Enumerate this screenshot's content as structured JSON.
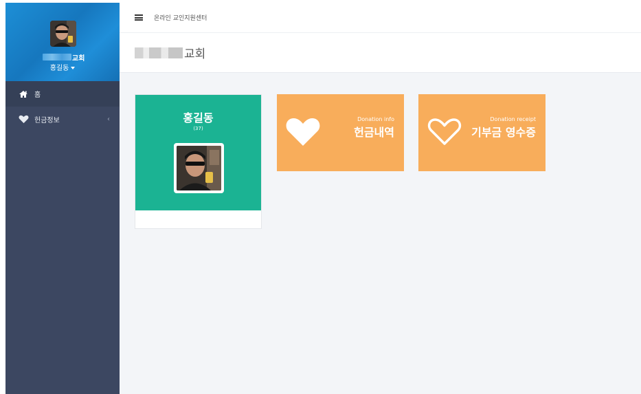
{
  "sidebar": {
    "profile": {
      "church_suffix": "교회",
      "user_name": "홍길동"
    },
    "items": [
      {
        "label": "홈",
        "icon": "home-icon",
        "active": true
      },
      {
        "label": "헌금정보",
        "icon": "heart-icon",
        "active": false,
        "chevron": "‹"
      }
    ]
  },
  "topbar": {
    "title": "온라인 교인지원센터"
  },
  "page_header": {
    "title_suffix": "교회"
  },
  "cards": {
    "profile": {
      "name": "홍길동",
      "age": "(37)"
    },
    "donation_info": {
      "subtitle": "Donation info",
      "title": "헌금내역"
    },
    "donation_receipt": {
      "subtitle": "Donation receipt",
      "title": "기부금 영수증"
    }
  },
  "colors": {
    "sidebar_bg": "#3c4761",
    "profile_bg": "#1677be",
    "green_card": "#1bb393",
    "orange_card": "#f8ad5b",
    "content_bg": "#f3f5f8"
  }
}
